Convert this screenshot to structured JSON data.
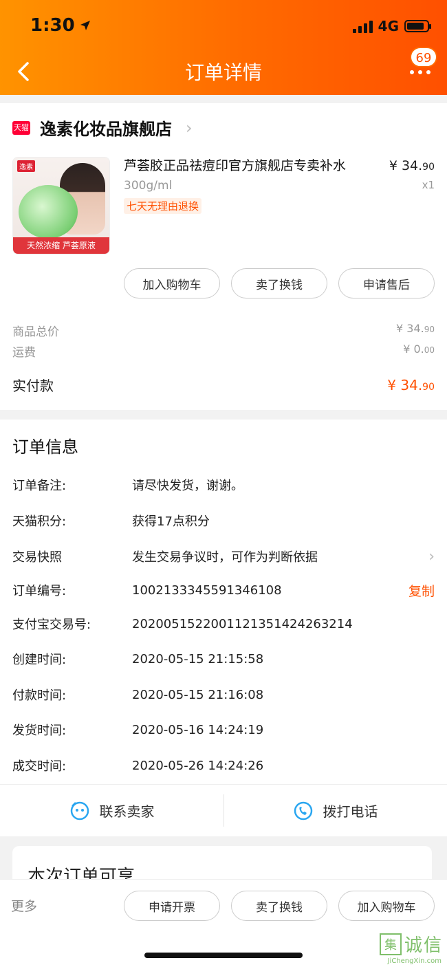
{
  "status_bar": {
    "time": "1:30",
    "network": "4G"
  },
  "nav": {
    "title": "订单详情",
    "badge": "69"
  },
  "shop": {
    "brand_tag": "天猫",
    "name": "逸素化妆品旗舰店"
  },
  "product": {
    "image_tag": "逸素",
    "image_banner": "天然浓缩 芦荟原液",
    "title": "芦荟胶正品祛痘印官方旗舰店专卖补水",
    "spec": "300g/ml",
    "service_tag": "七天无理由退换",
    "price_main": "¥ 34.",
    "price_cents": "90",
    "qty": "x1",
    "actions": [
      "加入购物车",
      "卖了换钱",
      "申请售后"
    ]
  },
  "summary": {
    "goods_total_label": "商品总价",
    "goods_total_main": "¥ 34.",
    "goods_total_cents": "90",
    "shipping_label": "运费",
    "shipping_main": "¥ 0.",
    "shipping_cents": "00",
    "paid_label": "实付款",
    "paid_main": "¥ 34.",
    "paid_cents": "90"
  },
  "order_info": {
    "title": "订单信息",
    "rows": [
      {
        "key": "订单备注:",
        "value": "请尽快发货，谢谢。"
      },
      {
        "key": "天猫积分:",
        "value": "获得17点积分"
      },
      {
        "key": "交易快照",
        "value": "发生交易争议时，可作为判断依据"
      },
      {
        "key": "订单编号:",
        "value": "1002133345591346108",
        "action": "复制"
      },
      {
        "key": "支付宝交易号:",
        "value": "2020051522001121351424263214"
      },
      {
        "key": "创建时间:",
        "value": "2020-05-15 21:15:58"
      },
      {
        "key": "付款时间:",
        "value": "2020-05-15 21:16:08"
      },
      {
        "key": "发货时间:",
        "value": "2020-05-16 14:24:19"
      },
      {
        "key": "成交时间:",
        "value": "2020-05-26 14:24:26"
      }
    ]
  },
  "contact": {
    "seller": "联系卖家",
    "phone": "拨打电话"
  },
  "share": {
    "title": "本次订单可享"
  },
  "bottom_bar": {
    "more": "更多",
    "buttons": [
      "申请开票",
      "卖了换钱",
      "加入购物车"
    ]
  },
  "watermark": {
    "box": "集",
    "text": "诚信",
    "sub": "JiChengXin.com"
  },
  "colors": {
    "accent": "#ff5000",
    "header_start": "#ff9300",
    "header_end": "#ff5000"
  }
}
